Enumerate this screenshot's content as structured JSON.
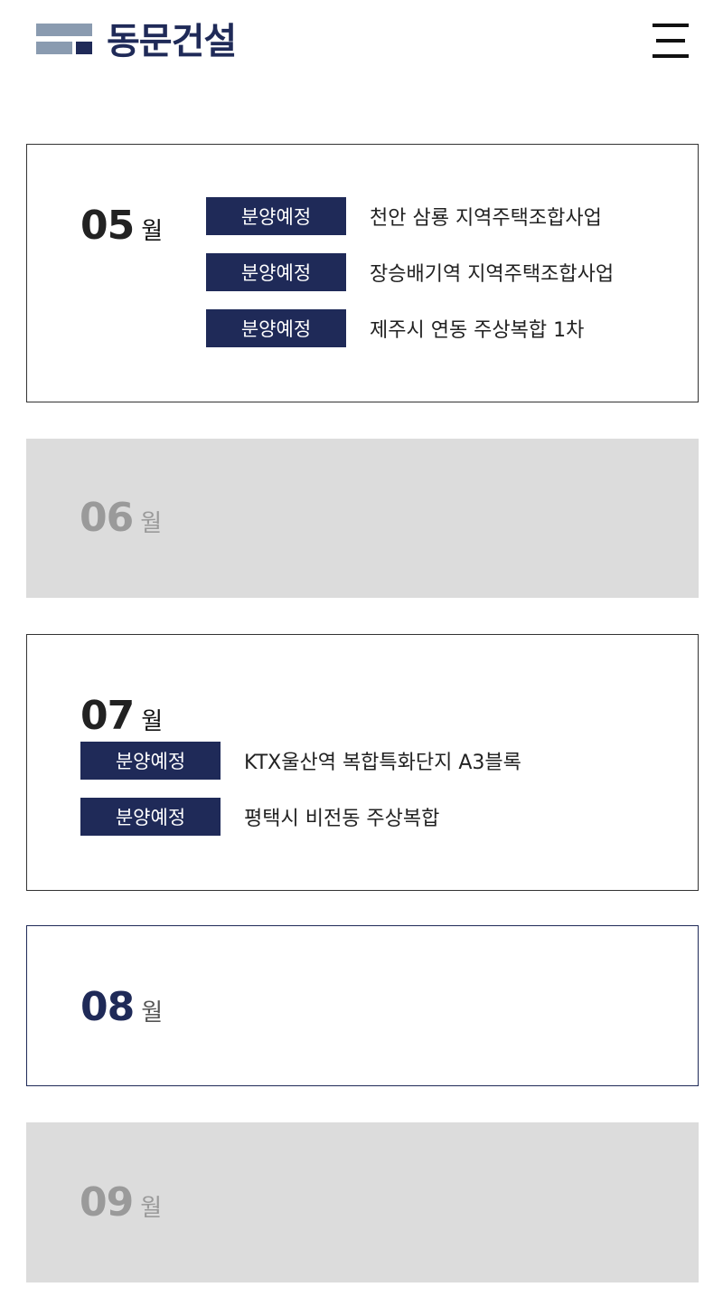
{
  "header": {
    "logo_text": "동문건설"
  },
  "months": [
    {
      "num": "05",
      "unit": "월",
      "entries": [
        {
          "badge": "분양예정",
          "title": "천안 삼룡 지역주택조합사업"
        },
        {
          "badge": "분양예정",
          "title": "장승배기역 지역주택조합사업"
        },
        {
          "badge": "분양예정",
          "title": "제주시 연동 주상복합 1차"
        }
      ]
    },
    {
      "num": "06",
      "unit": "월",
      "entries": []
    },
    {
      "num": "07",
      "unit": "월",
      "entries": [
        {
          "badge": "분양예정",
          "title": "KTX울산역 복합특화단지 A3블록"
        },
        {
          "badge": "분양예정",
          "title": "평택시 비전동 주상복합"
        }
      ]
    },
    {
      "num": "08",
      "unit": "월",
      "entries": []
    },
    {
      "num": "09",
      "unit": "월",
      "entries": []
    }
  ],
  "colors": {
    "brand_navy": "#1f2a58",
    "logo_gray_blue": "#8a9bb0",
    "inactive_bg": "#dcdcdc"
  }
}
